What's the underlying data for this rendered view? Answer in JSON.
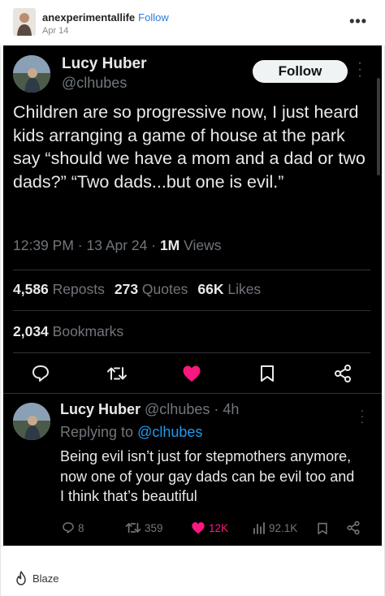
{
  "post": {
    "username": "anexperimentallife",
    "follow_label": "Follow",
    "date": "Apr 14",
    "more_icon": "more-horizontal-icon"
  },
  "tweet": {
    "name": "Lucy Huber",
    "handle": "@clhubes",
    "follow_label": "Follow",
    "text": "Children are so progressive now, I just heard kids arranging a game of house at the park say “should we have a mom and a dad or two dads?” “Two dads...but one is evil.”",
    "time": "12:39 PM · 13 Apr 24 · ",
    "views_count": "1M",
    "views_label": " Views",
    "reposts_count": "4,586",
    "reposts_label": " Reposts",
    "quotes_count": "273",
    "quotes_label": " Quotes",
    "likes_count": "66K",
    "likes_label": " Likes",
    "bookmarks_count": "2,034",
    "bookmarks_label": " Bookmarks",
    "like_color": "#f91880"
  },
  "reply": {
    "name": "Lucy Huber",
    "handle_time": " @clhubes · 4h",
    "replying_prefix": "Replying to ",
    "replying_handle": "@clhubes",
    "text": "Being evil isn’t just for stepmothers anymore, now one of your gay dads can be evil too and I think that’s beautiful",
    "replies": "8",
    "reposts": "359",
    "likes": "12K",
    "views": "92.1K"
  },
  "footer": {
    "blaze_label": "Blaze"
  }
}
